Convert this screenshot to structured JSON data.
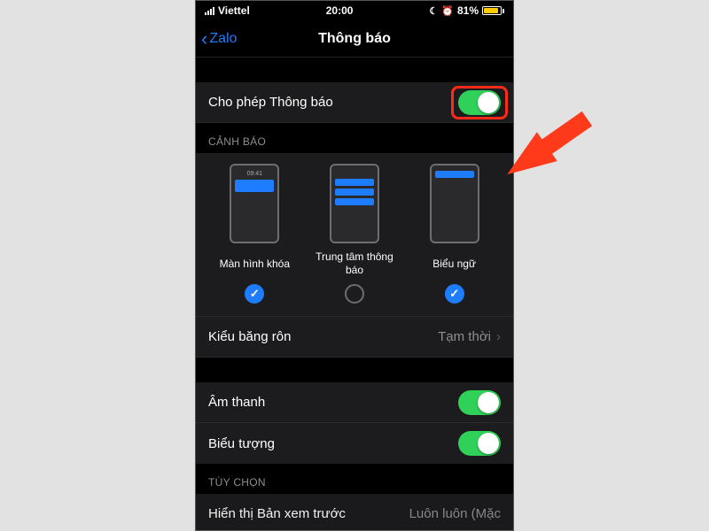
{
  "status": {
    "carrier": "Viettel",
    "time": "20:00",
    "battery_pct": "81%",
    "battery_fill_pct": 81
  },
  "nav": {
    "back_label": "Zalo",
    "title": "Thông báo"
  },
  "allowNotifications": {
    "label": "Cho phép Thông báo",
    "on": true
  },
  "alerts": {
    "header": "CẢNH BÁO",
    "options": [
      {
        "name": "Màn hình khóa",
        "checked": true
      },
      {
        "name": "Trung tâm thông báo",
        "checked": false
      },
      {
        "name": "Biểu ngữ",
        "checked": true
      }
    ],
    "banner_style": {
      "label": "Kiểu băng rôn",
      "value": "Tạm thời"
    }
  },
  "sound": {
    "label": "Âm thanh",
    "on": true
  },
  "badge": {
    "label": "Biểu tượng",
    "on": true
  },
  "options_header": "TÙY CHỌN",
  "preview": {
    "label": "Hiển thị Bản xem trước",
    "value": "Luôn luôn (Mặc"
  }
}
